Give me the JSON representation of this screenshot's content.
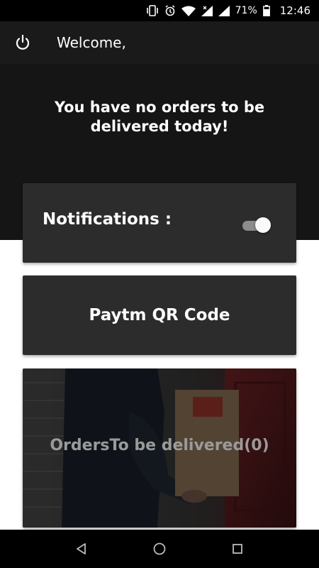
{
  "status_bar": {
    "battery": "71%",
    "time": "12:46",
    "icons": [
      "vibrate-icon",
      "alarm-icon",
      "wifi-icon",
      "signal-icon",
      "signal-icon",
      "battery-icon"
    ]
  },
  "app_bar": {
    "welcome": "Welcome,",
    "power_icon": "power-icon"
  },
  "hero": {
    "message": "You have no orders to be delivered today!"
  },
  "notifications_card": {
    "label": "Notifications :",
    "enabled": true
  },
  "paytm_card": {
    "label": "Paytm QR Code"
  },
  "orders_card": {
    "label": "OrdersTo be delivered(0)",
    "image": "delivery-person-photo"
  },
  "nav_bar": {
    "buttons": [
      "back-icon",
      "home-icon",
      "recents-icon"
    ]
  },
  "colors": {
    "header_bg": "#1a1a1a",
    "card_bg": "#2c2c2c",
    "text": "#ffffff"
  }
}
